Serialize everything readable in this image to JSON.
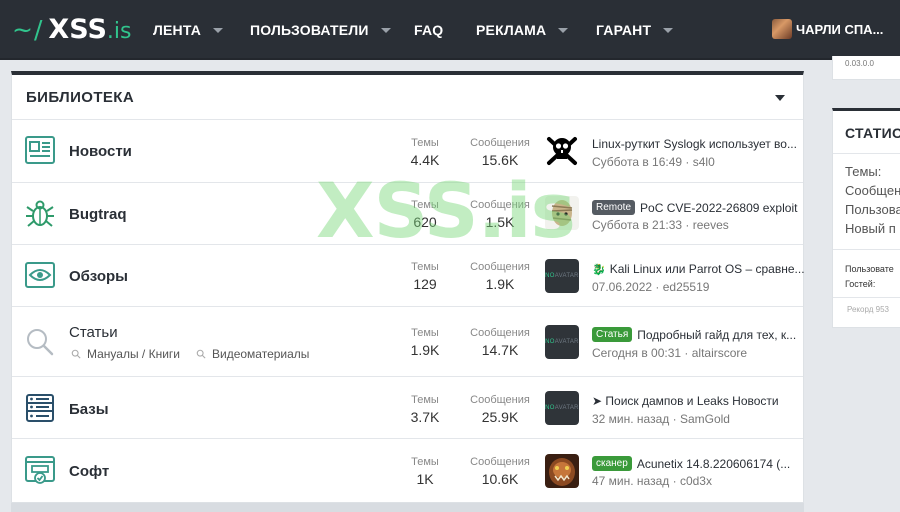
{
  "nav": {
    "logo": {
      "tilde": "~",
      "slash": "/",
      "xss": "XSS",
      "is": ".is"
    },
    "items": [
      {
        "label": "ЛЕНТА",
        "has_caret": true
      },
      {
        "label": "ПОЛЬЗОВАТЕЛИ",
        "has_caret": true
      },
      {
        "label": "FAQ",
        "has_caret": false
      },
      {
        "label": "РЕКЛАМА",
        "has_caret": true
      },
      {
        "label": "ГАРАНТ",
        "has_caret": true
      }
    ],
    "user": "ЧАРЛИ СПА..."
  },
  "section": {
    "title": "БИБЛИОТЕКА"
  },
  "labels": {
    "threads": "Темы",
    "messages": "Сообщения"
  },
  "forums": [
    {
      "icon": "newspaper-icon",
      "title": "Новости",
      "threads": "4.4K",
      "messages": "15.6K",
      "last_post": {
        "tag": "",
        "title": "Linux-руткит Syslogk использует во...",
        "meta": "Суббота в 16:49 · s4l0"
      }
    },
    {
      "icon": "bug-icon",
      "title": "Bugtraq",
      "threads": "620",
      "messages": "1.5K",
      "last_post": {
        "tag": "Remote",
        "title": "PoC CVE-2022-26809 exploit",
        "meta": "Суббота в 21:33 · reeves"
      }
    },
    {
      "icon": "eye-icon",
      "title": "Обзоры",
      "threads": "129",
      "messages": "1.9K",
      "last_post": {
        "tag": "",
        "title": "Kali Linux или Parrot OS – сравне...",
        "meta": "07.06.2022 · ed25519"
      }
    },
    {
      "icon": "search-icon",
      "title": "Статьи",
      "threads": "1.9K",
      "messages": "14.7K",
      "subforums": [
        "Мануалы / Книги",
        "Видеоматериалы"
      ],
      "last_post": {
        "tag": "Статья",
        "title": "Подробный гайд для тех, к...",
        "meta": "Сегодня в 00:31 · altairscore"
      }
    },
    {
      "icon": "database-icon",
      "title": "Базы",
      "threads": "3.7K",
      "messages": "25.9K",
      "last_post": {
        "tag": "",
        "title": "➤ Поиск дампов и Leaks Новости",
        "meta": "32 мин. назад · SamGold"
      }
    },
    {
      "icon": "software-icon",
      "title": "Софт",
      "threads": "1K",
      "messages": "10.6K",
      "last_post": {
        "tag": "сканер",
        "title": "Acunetix 14.8.220606174 (...",
        "meta": "47 мин. назад · c0d3x"
      }
    }
  ],
  "noavatar_text": {
    "no": "NO",
    "avatar": "AVATAR"
  },
  "sidebar": {
    "top_text": "0.03.0.0",
    "stats_title": "СТАТИС",
    "stats": [
      "Темы:",
      "Сообщен",
      "Пользова",
      "Новый п"
    ],
    "online": [
      "Пользовате",
      "Гостей:"
    ],
    "record": "Рекорд 953"
  },
  "watermark": "XSS.is",
  "colors": {
    "accent": "#31c48d",
    "navbar": "#2a2f36",
    "tag_remote": "#555b62",
    "tag_green": "#3a9a3a"
  }
}
